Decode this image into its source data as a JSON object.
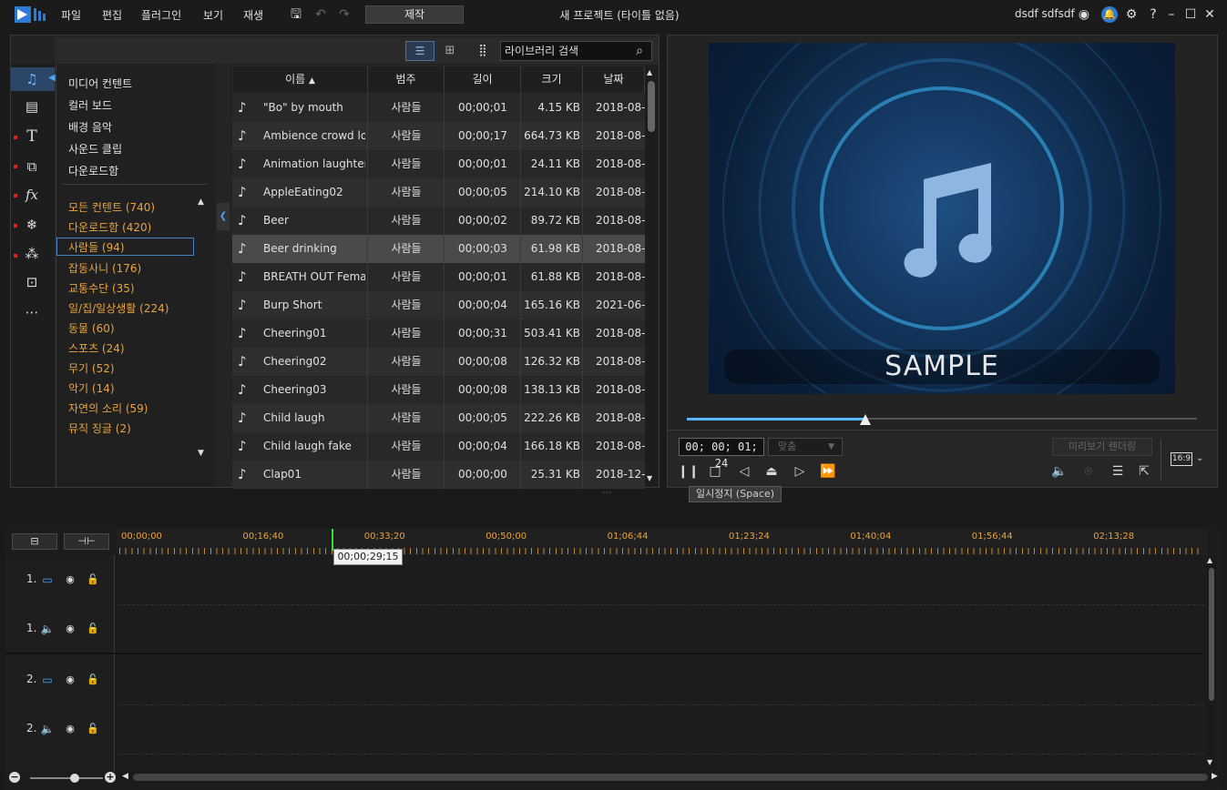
{
  "menu": [
    "파일",
    "편집",
    "플러그인",
    "보기",
    "재생"
  ],
  "produce_label": "제작",
  "window_title": "새 프로젝트 (타이틀 없음)",
  "user_name": "dsdf sdfsdf",
  "search": {
    "value": "라이브러리 검색"
  },
  "categories_top": [
    "미디어 컨텐트",
    "컬러 보드",
    "배경 음악",
    "사운드 클립",
    "다운로드함"
  ],
  "categories_tags": [
    "모든 컨텐트  (740)",
    "다운로드함  (420)",
    "사람들  (94)",
    "잡동사니  (176)",
    "교통수단  (35)",
    "일/집/일상생활  (224)",
    "동물  (60)",
    "스포츠  (24)",
    "무기  (52)",
    "악기  (14)",
    "자연의 소리  (59)",
    "뮤직 징글  (2)"
  ],
  "columns": {
    "name": "이름",
    "category": "범주",
    "length": "길이",
    "size": "크기",
    "date": "날짜"
  },
  "files": [
    {
      "name": "\"Bo\" by mouth",
      "category": "사람들",
      "length": "00;00;01",
      "size": "4.15 KB",
      "date": "2018-08-"
    },
    {
      "name": "Ambience crowd lo...",
      "category": "사람들",
      "length": "00;00;17",
      "size": "664.73 KB",
      "date": "2018-08-"
    },
    {
      "name": "Animation laughter",
      "category": "사람들",
      "length": "00;00;01",
      "size": "24.11 KB",
      "date": "2018-08-"
    },
    {
      "name": "AppleEating02",
      "category": "사람들",
      "length": "00;00;05",
      "size": "214.10 KB",
      "date": "2018-08-"
    },
    {
      "name": "Beer",
      "category": "사람들",
      "length": "00;00;02",
      "size": "89.72 KB",
      "date": "2018-08-"
    },
    {
      "name": "Beer drinking",
      "category": "사람들",
      "length": "00;00;03",
      "size": "61.98 KB",
      "date": "2018-08-"
    },
    {
      "name": "BREATH OUT Fema...",
      "category": "사람들",
      "length": "00;00;01",
      "size": "61.88 KB",
      "date": "2018-08-"
    },
    {
      "name": "Burp Short",
      "category": "사람들",
      "length": "00;00;04",
      "size": "165.16 KB",
      "date": "2021-06-"
    },
    {
      "name": "Cheering01",
      "category": "사람들",
      "length": "00;00;31",
      "size": "503.41 KB",
      "date": "2018-08-"
    },
    {
      "name": "Cheering02",
      "category": "사람들",
      "length": "00;00;08",
      "size": "126.32 KB",
      "date": "2018-08-"
    },
    {
      "name": "Cheering03",
      "category": "사람들",
      "length": "00;00;08",
      "size": "138.13 KB",
      "date": "2018-08-"
    },
    {
      "name": "Child laugh",
      "category": "사람들",
      "length": "00;00;05",
      "size": "222.26 KB",
      "date": "2018-08-"
    },
    {
      "name": "Child laugh fake",
      "category": "사람들",
      "length": "00;00;04",
      "size": "166.18 KB",
      "date": "2018-08-"
    },
    {
      "name": "Clap01",
      "category": "사람들",
      "length": "00;00;00",
      "size": "25.31 KB",
      "date": "2018-12-"
    }
  ],
  "preview": {
    "sample_text": "SAMPLE",
    "timecode": "00; 00; 01; 24",
    "fit_label": "맞춤",
    "render_label": "미리보기 렌더링",
    "tooltip": "일시정지 (Space)",
    "aspect": "16:9",
    "progress_fraction": 0.35
  },
  "timeline": {
    "ruler": [
      "00;00;00",
      "00;16;40",
      "00;33;20",
      "00;50;00",
      "01;06;44",
      "01;23;24",
      "01;40;04",
      "01;56;44",
      "02;13;28"
    ],
    "playhead_timecode": "00;00;29;15",
    "tracks": [
      {
        "num": "1.",
        "type": "video"
      },
      {
        "num": "1.",
        "type": "audio"
      },
      {
        "num": "2.",
        "type": "video"
      },
      {
        "num": "2.",
        "type": "audio"
      }
    ]
  },
  "colors": {
    "accent_orange": "#e8a33c",
    "accent_blue": "#4aa8ff",
    "playhead": "#37e037"
  }
}
